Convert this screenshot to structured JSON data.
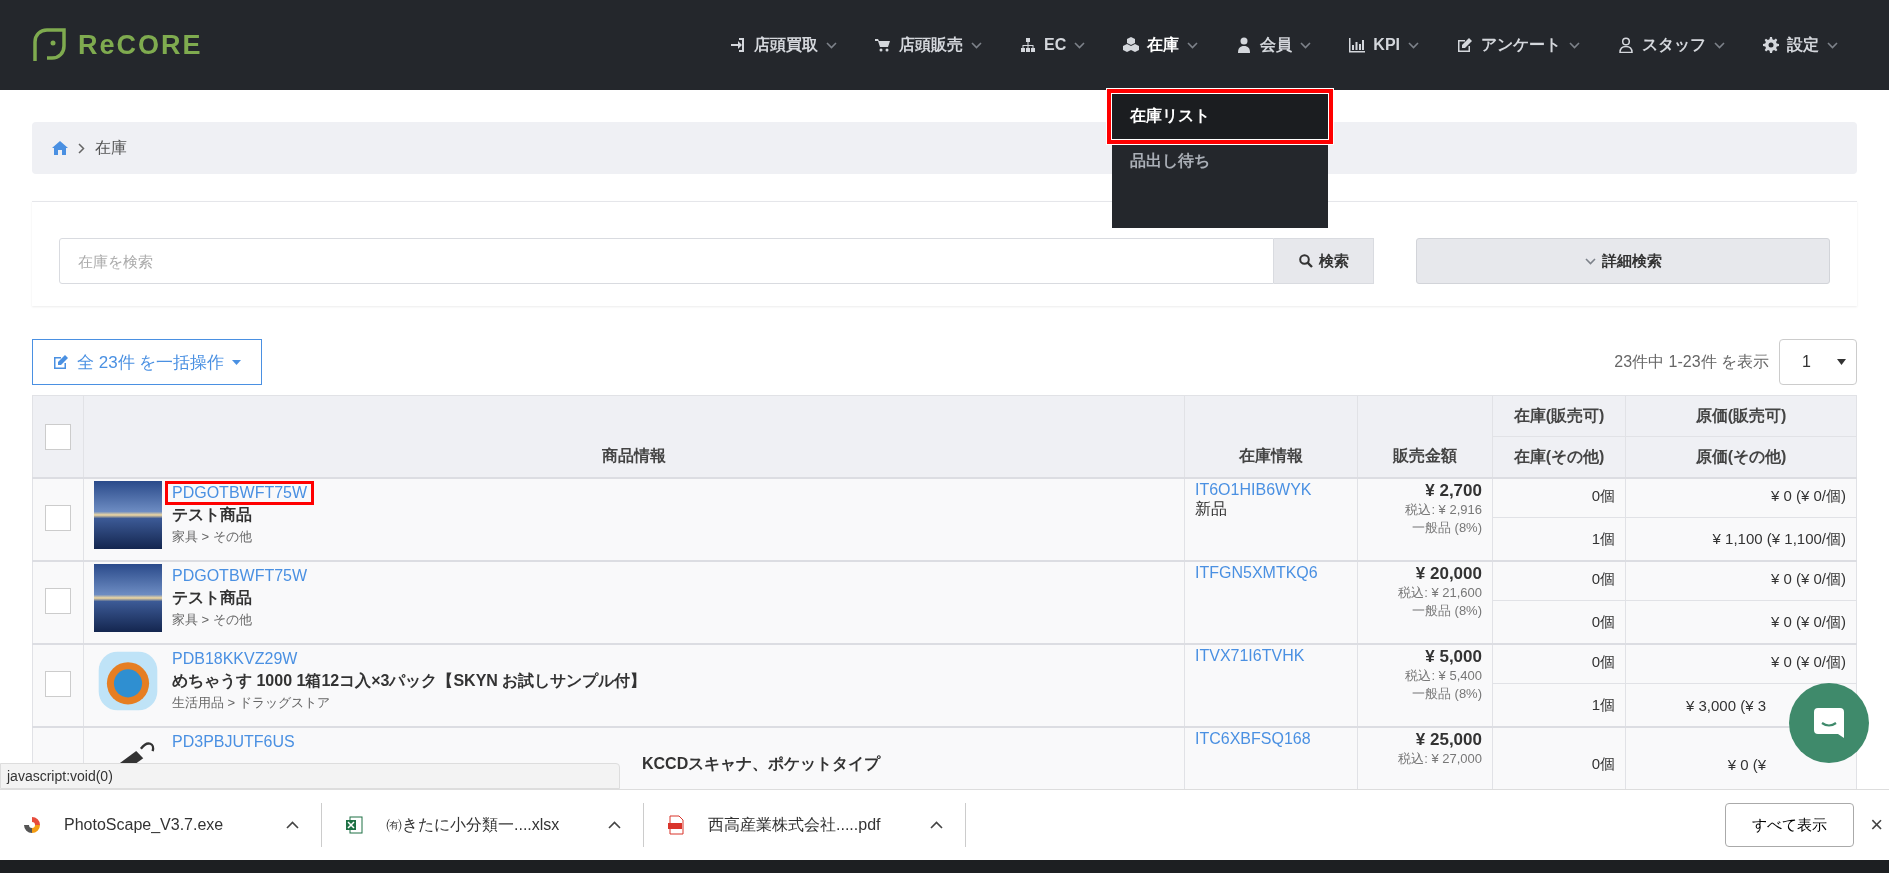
{
  "header": {
    "logo": "ReCORE",
    "nav": [
      {
        "label": "店頭買取",
        "expanded": false
      },
      {
        "label": "店頭販売",
        "expanded": false
      },
      {
        "label": "EC",
        "expanded": false
      },
      {
        "label": "在庫",
        "expanded": true,
        "menu": [
          {
            "label": "在庫リスト",
            "selected": true,
            "highlighted": true
          },
          {
            "label": "品出し待ち",
            "selected": false,
            "highlighted": false
          }
        ]
      },
      {
        "label": "会員",
        "expanded": false
      },
      {
        "label": "KPI",
        "expanded": false
      },
      {
        "label": "アンケート",
        "expanded": false
      },
      {
        "label": "スタッフ",
        "expanded": false
      },
      {
        "label": "設定",
        "expanded": false
      }
    ]
  },
  "breadcrumb": {
    "current": "在庫"
  },
  "search": {
    "placeholder": "在庫を検索",
    "button": "検索",
    "advanced": "詳細検索"
  },
  "toolbar": {
    "bulk_action": "全 23件 を一括操作",
    "summary": "23件中 1-23件 を表示",
    "page": "1"
  },
  "table": {
    "header_checked": false,
    "columns": {
      "product": "商品情報",
      "stock_info": "在庫情報",
      "price": "販売金額",
      "stock_sellable": "在庫(販売可)",
      "stock_other": "在庫(その他)",
      "cost_sellable": "原価(販売可)",
      "cost_other": "原価(その他)"
    },
    "rows": [
      {
        "checked": false,
        "code": "PDGOTBWFT75W",
        "code_highlighted": true,
        "name": "テスト商品",
        "category": "家具 > その他",
        "stock_code": "IT6O1HIB6WYK",
        "condition": "新品",
        "price": "¥ 2,700",
        "tax_included": "税込: ¥ 2,916",
        "tax_class": "一般品 (8%)",
        "lines": [
          {
            "qty": "0個",
            "cost": "¥ 0 (¥ 0/個)",
            "covered": false
          },
          {
            "qty": "1個",
            "cost": "¥ 1,100 (¥ 1,100/個)",
            "covered": false
          }
        ]
      },
      {
        "checked": false,
        "code": "PDGOTBWFT75W",
        "code_highlighted": false,
        "name": "テスト商品",
        "category": "家具 > その他",
        "stock_code": "ITFGN5XMTKQ6",
        "price": "¥ 20,000",
        "tax_included": "税込: ¥ 21,600",
        "tax_class": "一般品 (8%)",
        "lines": [
          {
            "qty": "0個",
            "cost": "¥ 0 (¥ 0/個)",
            "covered": false
          },
          {
            "qty": "0個",
            "cost": "¥ 0 (¥ 0/個)",
            "covered": false
          }
        ]
      },
      {
        "checked": false,
        "code": "PDB18KKVZ29W",
        "code_highlighted": false,
        "name": "めちゃうす 1000 1箱12コ入×3パック【SKYN お試しサンプル付】",
        "category": "生活用品 > ドラッグストア",
        "stock_code": "ITVX71I6TVHK",
        "price": "¥ 5,000",
        "tax_included": "税込: ¥ 5,400",
        "tax_class": "一般品 (8%)",
        "lines": [
          {
            "qty": "0個",
            "cost": "¥ 0 (¥ 0/個)",
            "covered": false
          },
          {
            "qty": "1個",
            "cost": "¥ 3,000 (¥ 3",
            "covered": true
          }
        ]
      },
      {
        "code": "PD3PBJUTF6US",
        "code_highlighted": false,
        "name": "KCCDスキャナ、ポケットタイプ",
        "name_covered": true,
        "stock_code": "ITC6XBFSQ168",
        "price": "¥ 25,000",
        "tax_included": "税込: ¥ 27,000",
        "lines": [
          {
            "qty": "0個",
            "cost": "¥ 0 (¥",
            "covered": true
          }
        ]
      }
    ]
  },
  "status_bar": {
    "text": "javascript:void(0)"
  },
  "downloads": {
    "items": [
      {
        "name": "PhotoScape_V3.7.exe",
        "kind": "exe"
      },
      {
        "name": "㈲きたに小分類一....xlsx",
        "kind": "xlsx"
      },
      {
        "name": "西高産業株式会社.....pdf",
        "kind": "pdf"
      }
    ],
    "show_all": "すべて表示",
    "close": "×"
  }
}
